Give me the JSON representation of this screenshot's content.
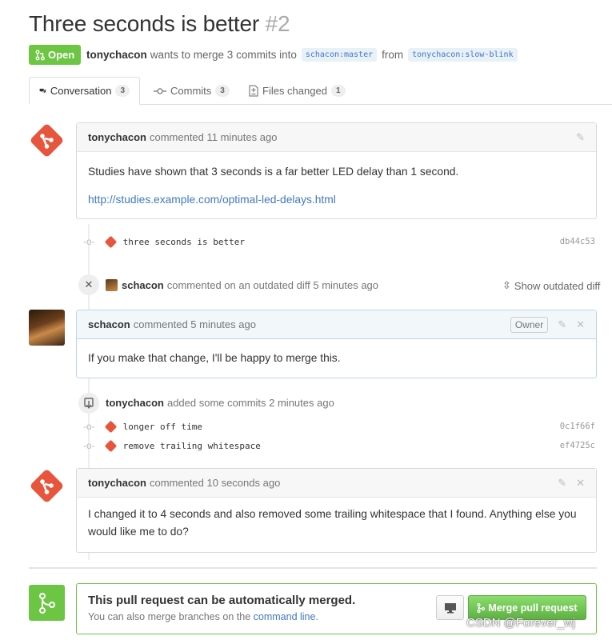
{
  "header": {
    "title": "Three seconds is better",
    "number": "#2",
    "state": "Open",
    "author": "tonychacon",
    "summary": "wants to merge 3 commits into",
    "base_branch": "schacon:master",
    "from_word": "from",
    "head_branch": "tonychacon:slow-blink"
  },
  "tabs": [
    {
      "label": "Conversation",
      "count": "3",
      "icon": "comment-discussion-icon"
    },
    {
      "label": "Commits",
      "count": "3",
      "icon": "git-commit-icon"
    },
    {
      "label": "Files changed",
      "count": "1",
      "icon": "diff-icon"
    }
  ],
  "comments": [
    {
      "author": "tonychacon",
      "meta": "commented 11 minutes ago",
      "body": "Studies have shown that 3 seconds is a far better LED delay than 1 second.",
      "link": "http://studies.example.com/optimal-led-delays.html"
    },
    {
      "author": "schacon",
      "meta": "commented 5 minutes ago",
      "badge": "Owner",
      "body": "If you make that change, I'll be happy to merge this."
    },
    {
      "author": "tonychacon",
      "meta": "commented 10 seconds ago",
      "body": "I changed it to 4 seconds and also removed some trailing whitespace that I found. Anything else you would like me to do?"
    }
  ],
  "commits_group1": [
    {
      "message": "three seconds is better",
      "sha": "db44c53"
    }
  ],
  "outdated_event": {
    "author": "schacon",
    "text": "commented on an outdated diff 5 minutes ago",
    "action": "Show outdated diff"
  },
  "commits_event": {
    "author": "tonychacon",
    "text": "added some commits 2 minutes ago"
  },
  "commits_group2": [
    {
      "message": "longer off time",
      "sha": "0c1f66f"
    },
    {
      "message": "remove trailing whitespace",
      "sha": "ef4725c"
    }
  ],
  "merge": {
    "title": "This pull request can be automatically merged.",
    "subtitle": "You can also merge branches on the",
    "link": "command line",
    "link_suffix": ".",
    "button": "Merge pull request"
  },
  "watermark": "CSDN @Forever_wj",
  "colors": {
    "open_green": "#6cc644",
    "git_red": "#e8553d",
    "link_blue": "#4078c0"
  }
}
